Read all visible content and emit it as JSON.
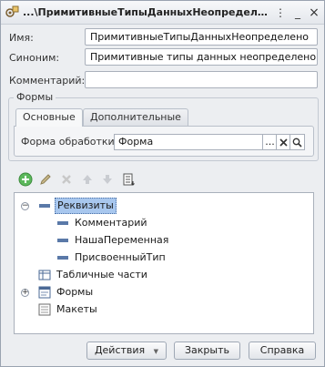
{
  "window": {
    "title": "...\\ПримитивныеТипыДанныхНеопределено",
    "grip_glyph": "⋮",
    "minimize_glyph": "_",
    "close_glyph": "×"
  },
  "fields": {
    "name_label": "Имя:",
    "name_value": "ПримитивныеТипыДанныхНеопределено",
    "synonym_label": "Синоним:",
    "synonym_value": "Примитивные типы данных неопределено",
    "comment_label": "Комментарий:",
    "comment_value": ""
  },
  "forms_group": {
    "title": "Формы",
    "tabs": [
      {
        "label": "Основные"
      },
      {
        "label": "Дополнительные"
      }
    ],
    "processing_form_label": "Форма обработки:",
    "processing_form_value": "Форма",
    "select_glyph": "...",
    "clear_glyph": "✕",
    "open_glyph": "🔍"
  },
  "toolbar": {
    "icons": [
      "add-icon",
      "edit-icon",
      "delete-icon",
      "move-up-icon",
      "move-down-icon",
      "sort-list-icon"
    ]
  },
  "tree": {
    "nodes": [
      {
        "label": "Реквизиты",
        "icon": "attributes-icon"
      },
      {
        "label": "Комментарий",
        "icon": "attribute-icon"
      },
      {
        "label": "НашаПеременная",
        "icon": "attribute-icon"
      },
      {
        "label": "ПрисвоенныйТип",
        "icon": "attribute-icon"
      },
      {
        "label": "Табличные части",
        "icon": "table-icon"
      },
      {
        "label": "Формы",
        "icon": "form-icon"
      },
      {
        "label": "Макеты",
        "icon": "layout-icon"
      }
    ],
    "expand_minus": "−",
    "expand_plus": "+"
  },
  "buttons": {
    "actions": "Действия",
    "actions_arrow": "▼",
    "close": "Закрыть",
    "help": "Справка"
  },
  "colors": {
    "selection": "#a8c7ee",
    "add_icon": "#4caf50"
  }
}
